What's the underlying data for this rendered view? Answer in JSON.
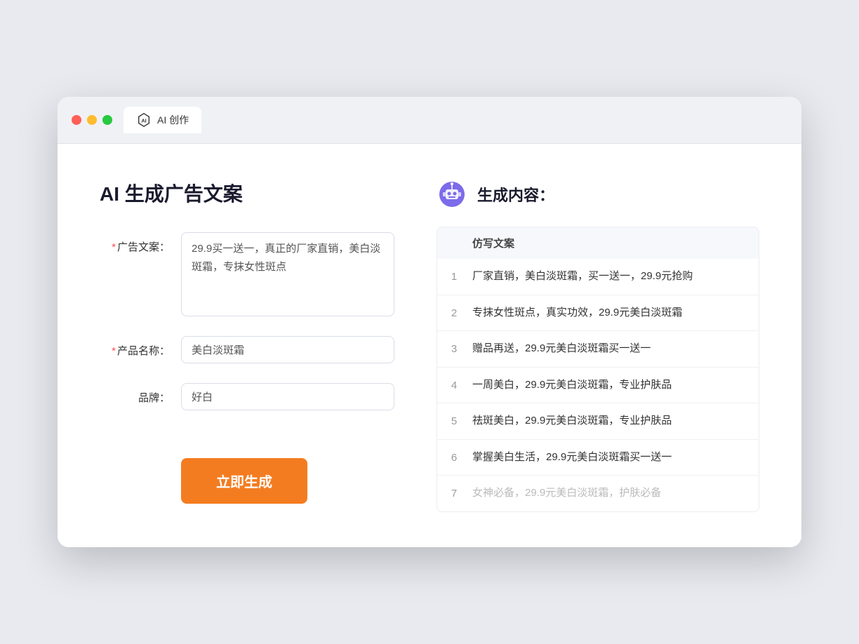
{
  "browser": {
    "tab_label": "AI 创作"
  },
  "page": {
    "title": "AI 生成广告文案",
    "result_title": "生成内容："
  },
  "form": {
    "ad_label": "广告文案：",
    "ad_required": "*",
    "ad_value": "29.9买一送一，真正的厂家直销，美白淡斑霜，专抹女性斑点",
    "product_label": "产品名称：",
    "product_required": "*",
    "product_value": "美白淡斑霜",
    "brand_label": "品牌：",
    "brand_value": "好白",
    "submit_label": "立即生成"
  },
  "result": {
    "table_header": "仿写文案",
    "items": [
      {
        "num": "1",
        "text": "厂家直销，美白淡斑霜，买一送一，29.9元抢购",
        "muted": false
      },
      {
        "num": "2",
        "text": "专抹女性斑点，真实功效，29.9元美白淡斑霜",
        "muted": false
      },
      {
        "num": "3",
        "text": "赠品再送，29.9元美白淡斑霜买一送一",
        "muted": false
      },
      {
        "num": "4",
        "text": "一周美白，29.9元美白淡斑霜，专业护肤品",
        "muted": false
      },
      {
        "num": "5",
        "text": "祛斑美白，29.9元美白淡斑霜，专业护肤品",
        "muted": false
      },
      {
        "num": "6",
        "text": "掌握美白生活，29.9元美白淡斑霜买一送一",
        "muted": false
      },
      {
        "num": "7",
        "text": "女神必备，29.9元美白淡斑霜，护肤必备",
        "muted": true
      }
    ]
  }
}
